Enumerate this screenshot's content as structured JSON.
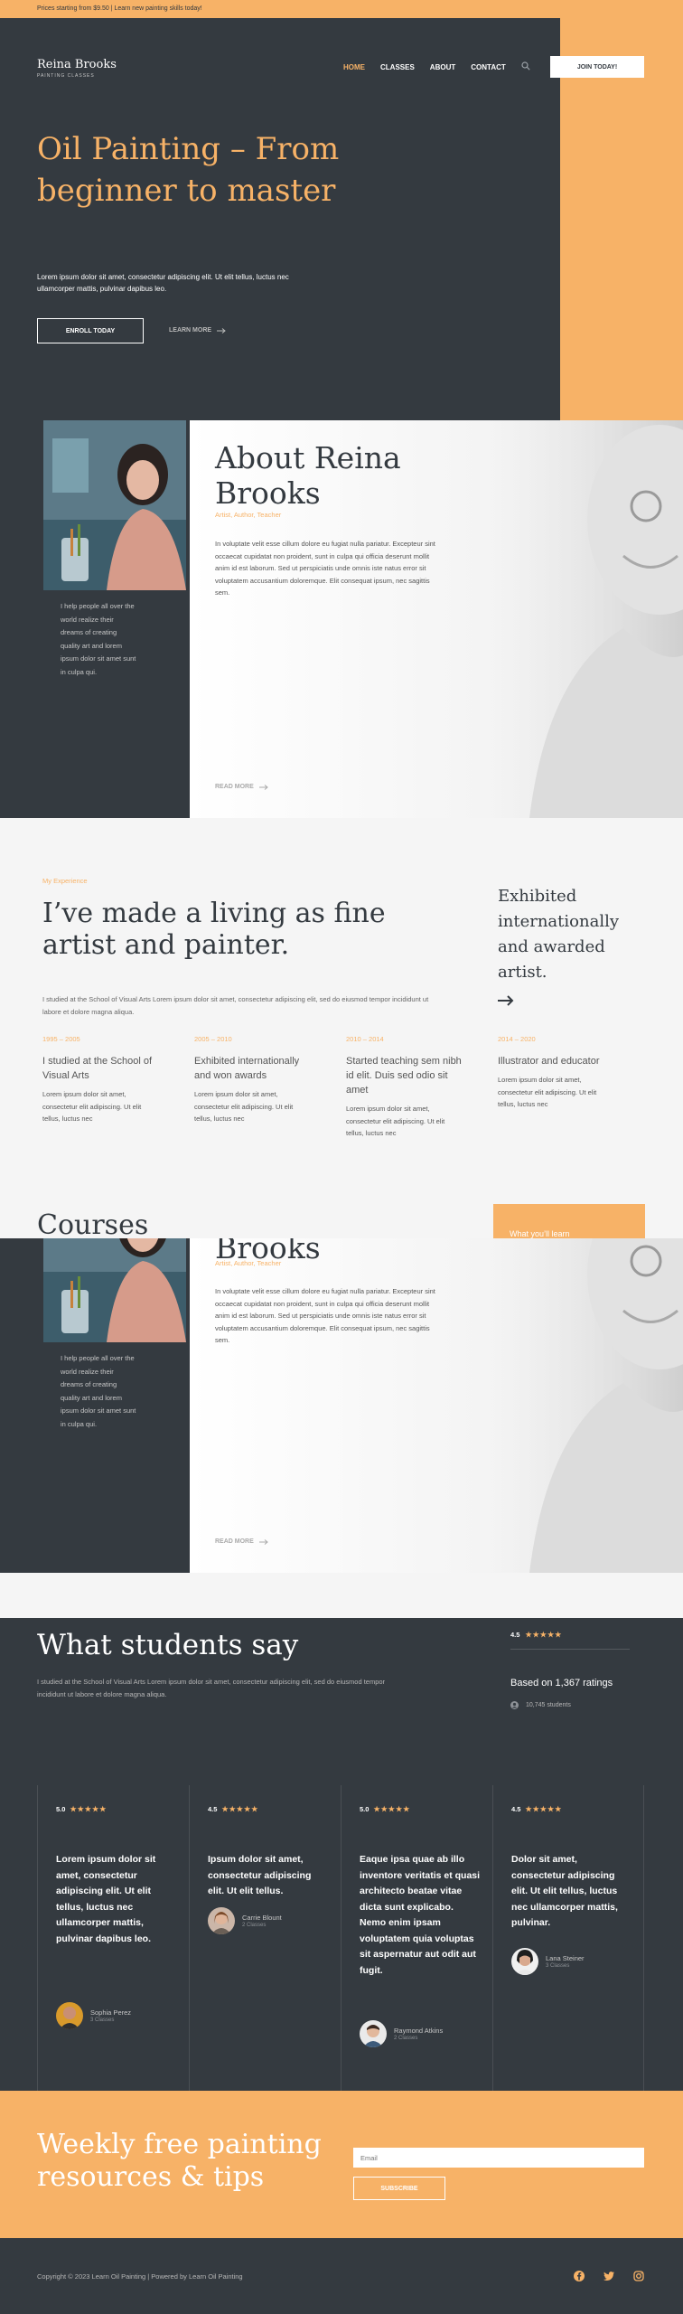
{
  "topbar": {
    "text": "Prices starting from $9.50 | Learn new painting skills today!"
  },
  "brand": {
    "name": "Reina Brooks",
    "subtitle": "PAINTING CLASSES"
  },
  "nav": {
    "items": [
      {
        "label": "HOME",
        "active": true
      },
      {
        "label": "CLASSES",
        "active": false
      },
      {
        "label": "ABOUT",
        "active": false
      },
      {
        "label": "CONTACT",
        "active": false
      }
    ],
    "search_icon": "search-icon",
    "cta_label": "JOIN TODAY!"
  },
  "hero": {
    "title": "Oil Painting – From beginner to master",
    "description": "Lorem ipsum dolor sit amet, consectetur adipiscing elit. Ut elit tellus, luctus nec ullamcorper mattis, pulvinar dapibus leo.",
    "primary_button": "ENROLL TODAY",
    "secondary_link": "LEARN MORE"
  },
  "about": {
    "quote": "I help people all over the world realize their dreams of creating quality art and lorem ipsum dolor sit amet sunt in culpa qui.",
    "title": "About Reina Brooks",
    "roles": "Artist, Author, Teacher",
    "text": "In voluptate velit esse cillum dolore eu fugiat nulla pariatur. Excepteur sint occaecat cupidatat non proident, sunt in culpa qui officia deserunt mollit anim id est laborum. Sed ut perspiciatis unde omnis iste natus error sit voluptatem accusantium doloremque. Elit consequat ipsum, nec sagittis sem.",
    "read_more": "READ MORE"
  },
  "experience": {
    "kicker": "My Experience",
    "title": "I’ve made a living as fine artist and painter.",
    "intro": "I studied at the School of Visual Arts Lorem ipsum dolor sit amet, consectetur adipiscing elit, sed do eiusmod tempor incididunt ut labore et dolore magna aliqua.",
    "side_text": "Exhibited internationally and awarded artist.",
    "timeline": [
      {
        "years": "1995 – 2005",
        "title": "I studied at the School of Visual Arts",
        "text": "Lorem ipsum dolor sit amet, consectetur elit adipiscing. Ut elit tellus, luctus nec"
      },
      {
        "years": "2005 – 2010",
        "title": "Exhibited internationally and won awards",
        "text": "Lorem ipsum dolor sit amet, consectetur elit adipiscing. Ut elit tellus, luctus nec"
      },
      {
        "years": "2010 – 2014",
        "title": "Started teaching sem nibh id elit. Duis sed odio sit amet",
        "text": "Lorem ipsum dolor sit amet, consectetur elit adipiscing. Ut elit tellus, luctus nec"
      },
      {
        "years": "2014 – 2020",
        "title": "Illustrator and educator",
        "text": "Lorem ipsum dolor sit amet, consectetur elit adipiscing. Ut elit tellus, luctus nec"
      }
    ]
  },
  "courses": {
    "title": "Courses",
    "button": "What you’ll learn"
  },
  "testimonials": {
    "title": "What students say",
    "intro": "I studied at the School of Visual Arts Lorem ipsum dolor sit amet, consectetur adipiscing elit, sed do eiusmod tempor incididunt ut labore et dolore magna aliqua.",
    "overall_rating": "4.5",
    "overall_stars": "★★★★★",
    "based_on": "Based on 1,367 ratings",
    "students": "10,745 students",
    "cards": [
      {
        "rating": "5.0",
        "stars": "★★★★★",
        "quote": "Lorem ipsum dolor sit amet, consectetur adipiscing elit. Ut elit tellus, luctus nec ullamcorper mattis, pulvinar dapibus leo.",
        "name": "Sophia Perez",
        "classes": "3 Classes"
      },
      {
        "rating": "4.5",
        "stars": "★★★★★",
        "quote": "Ipsum dolor sit amet, consectetur adipiscing elit. Ut elit tellus.",
        "name": "Carrie Blount",
        "classes": "2 Classes"
      },
      {
        "rating": "5.0",
        "stars": "★★★★★",
        "quote": "Eaque ipsa quae ab illo inventore veritatis et quasi architecto beatae vitae dicta sunt explicabo. Nemo enim ipsam voluptatem quia voluptas sit aspernatur aut odit aut fugit.",
        "name": "Raymond Atkins",
        "classes": "2 Classes"
      },
      {
        "rating": "4.5",
        "stars": "★★★★★",
        "quote": "Dolor sit amet, consectetur adipiscing elit. Ut elit tellus, luctus nec ullamcorper mattis, pulvinar.",
        "name": "Lana Steiner",
        "classes": "3 Classes"
      }
    ]
  },
  "newsletter": {
    "title": "Weekly free painting resources & tips",
    "email_placeholder": "Email",
    "button": "SUBSCRIBE"
  },
  "footer": {
    "copyright": "Copyright © 2023 Learn Oil Painting | Powered by Learn Oil Painting",
    "social": [
      "facebook-icon",
      "twitter-icon",
      "instagram-icon"
    ]
  },
  "colors": {
    "accent": "#f7b267",
    "dark": "#343a40",
    "light": "#f5f5f5"
  }
}
